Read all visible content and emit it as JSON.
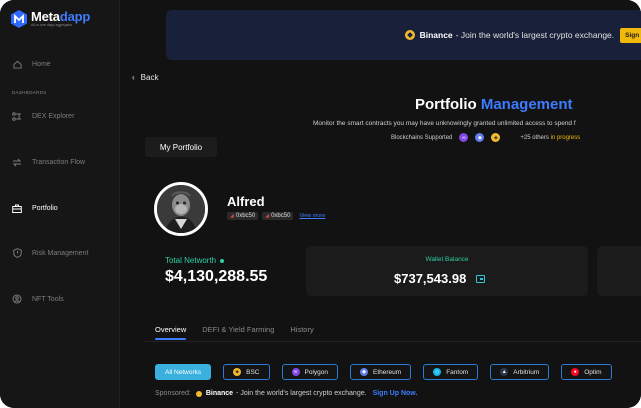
{
  "brand": {
    "name_prefix": "Meta",
    "name_suffix": "dapp",
    "tagline": "All-in-one dapp aggregator"
  },
  "sidebar": {
    "section_label": "DASHBOARDS",
    "items": [
      {
        "label": "Home",
        "icon": "home-icon"
      },
      {
        "label": "DEX Explorer",
        "icon": "dex-icon"
      },
      {
        "label": "Transaction Flow",
        "icon": "transfer-icon"
      },
      {
        "label": "Portfolio",
        "icon": "briefcase-icon",
        "active": true
      },
      {
        "label": "Risk Management",
        "icon": "shield-icon"
      },
      {
        "label": "NFT Tools",
        "icon": "nft-icon"
      }
    ]
  },
  "banner": {
    "brand": "Binance",
    "text": " - Join the world's largest crypto exchange.",
    "button": "Sign up"
  },
  "back_label": "Back",
  "page": {
    "title_white": "Portfolio",
    "title_blue": "Management",
    "subtitle": "Monitor the smart contracts you may have unknowingly granted  unlimited access to spend f",
    "chains_label": "Blockchains Supported",
    "others_prefix": "+25 others",
    "others_status": "in progress"
  },
  "my_portfolio_label": "My Portfolio",
  "profile": {
    "name": "Alfred",
    "addresses": [
      "0xbc50",
      "0xbc50"
    ],
    "view_more": "View more"
  },
  "stats": {
    "networth_label": "Total Networth",
    "networth_value": "$4,130,288.55",
    "wallet_label": "Wallet Balance",
    "wallet_value": "$737,543.98"
  },
  "tabs": [
    {
      "label": "Overview",
      "active": true
    },
    {
      "label": "DEFI & Yield Farming",
      "active": false
    },
    {
      "label": "History",
      "active": false
    }
  ],
  "networks": [
    {
      "label": "All Networks",
      "active": true,
      "icon": "",
      "color": "#3ab0df"
    },
    {
      "label": "BSC",
      "active": false,
      "icon": "bsc-icon",
      "color": "#f3ba2f"
    },
    {
      "label": "Polygon",
      "active": false,
      "icon": "polygon-icon",
      "color": "#8247e5"
    },
    {
      "label": "Ethereum",
      "active": false,
      "icon": "ethereum-icon",
      "color": "#627eea"
    },
    {
      "label": "Fantom",
      "active": false,
      "icon": "fantom-icon",
      "color": "#13b5ec"
    },
    {
      "label": "Arbitrium",
      "active": false,
      "icon": "arbitrum-icon",
      "color": "#2d374b"
    },
    {
      "label": "Optim",
      "active": false,
      "icon": "optimism-icon",
      "color": "#ff0420"
    }
  ],
  "sponsored": {
    "label": "Sponsored:",
    "brand": "Binance",
    "text": " - Join the world's largest crypto exchange.",
    "cta": "Sign Up Now."
  },
  "colors": {
    "accent_blue": "#3d7bff",
    "accent_green": "#2ecfa0",
    "binance_yellow": "#f0b90b"
  }
}
